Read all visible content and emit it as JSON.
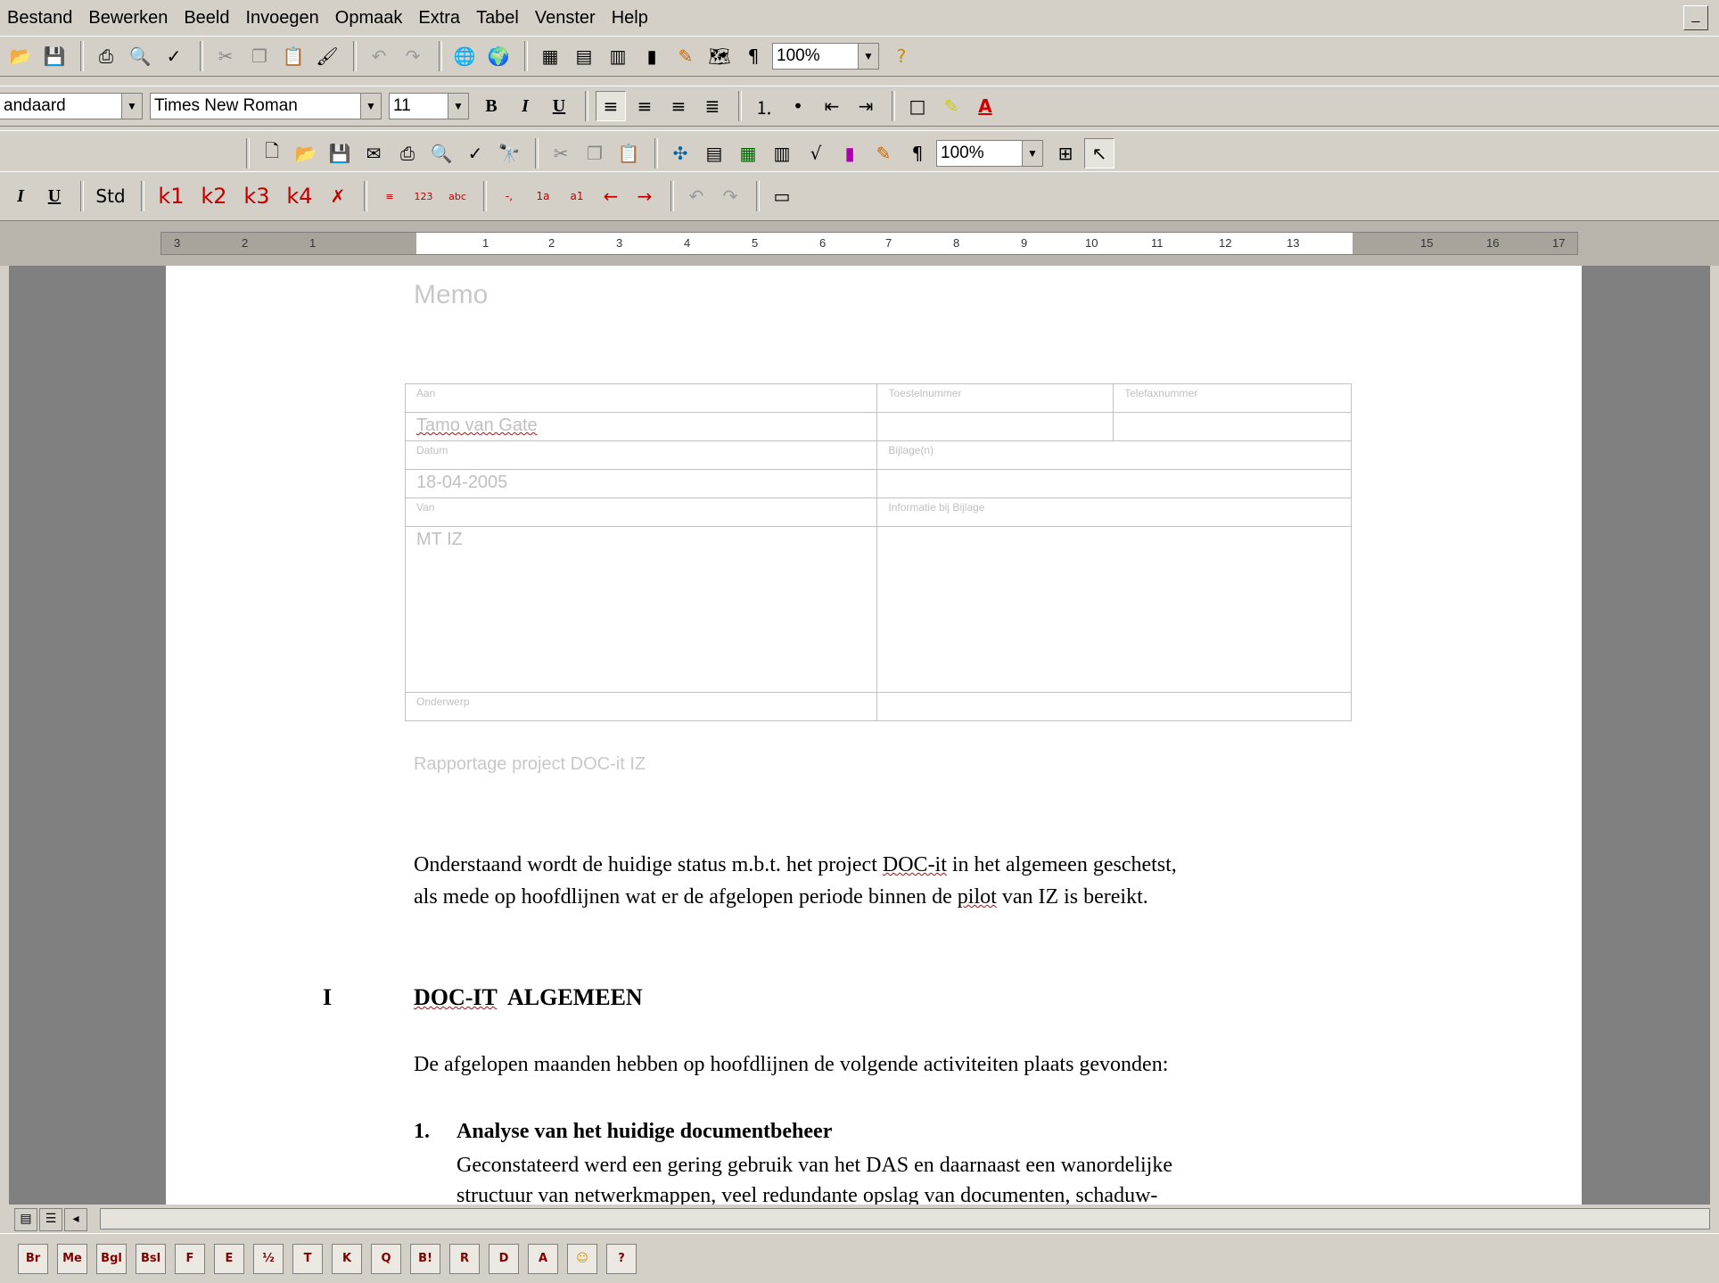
{
  "menubar": {
    "items": [
      "Bestand",
      "Bewerken",
      "Beeld",
      "Invoegen",
      "Opmaak",
      "Extra",
      "Tabel",
      "Venster",
      "Help"
    ],
    "min_button": "_"
  },
  "toolbar1": {
    "icons": [
      "open-icon",
      "save-icon",
      "print-icon",
      "print-preview-icon",
      "spelling-icon",
      "cut-icon",
      "copy-icon",
      "paste-icon",
      "format-painter-icon",
      "undo-icon",
      "redo-icon",
      "hyperlink-icon",
      "web-toolbar-icon",
      "tables-icon",
      "insert-table-icon",
      "insert-excel-icon",
      "columns-icon",
      "drawing-icon",
      "document-map-icon",
      "show-formatting-icon",
      "help-icon"
    ],
    "zoom": "100%"
  },
  "toolbar2": {
    "style": "andaard",
    "font": "Times New Roman",
    "size": "11",
    "bold": "B",
    "italic": "I",
    "underline": "U",
    "font_color_label": "A"
  },
  "toolbar3": {
    "zoom": "100%",
    "pilcrow": "¶"
  },
  "toolbar4": {
    "italic": "I",
    "underline": "U",
    "std": "Std",
    "k1": "k1",
    "k2": "k2",
    "k3": "k3",
    "k4": "k4"
  },
  "ruler": {
    "ticks": [
      "3",
      "2",
      "1",
      "1",
      "2",
      "3",
      "4",
      "5",
      "6",
      "7",
      "8",
      "9",
      "10",
      "11",
      "12",
      "13",
      "15",
      "16",
      "17"
    ]
  },
  "document": {
    "memo_title": "Memo",
    "form": {
      "aan_label": "Aan",
      "toestel_label": "Toestelnummer",
      "telefax_label": "Telefaxnummer",
      "aan_value": "Tamo van Gate",
      "datum_label": "Datum",
      "bijlage_label": "Bijlage(n)",
      "datum_value": "18-04-2005",
      "van_label": "Van",
      "informatie_label": "Informatie bij Bijlage",
      "van_value": "MT IZ",
      "onderwerp_label": "Onderwerp"
    },
    "under_table": "Rapportage project DOC-it IZ",
    "paragraph1_line1_a": "Onderstaand wordt de huidige status m.b.t. het project ",
    "paragraph1_line1_b": "DOC-it",
    "paragraph1_line1_c": " in het algemeen geschetst,",
    "paragraph1_line2_a": "als mede op hoofdlijnen wat er de afgelopen periode binnen de ",
    "paragraph1_line2_b": "pilot",
    "paragraph1_line2_c": " van IZ is bereikt.",
    "heading_num": "I",
    "heading_a": "DOC-IT",
    "heading_b": "  ALGEMEEN",
    "paragraph2": "De afgelopen maanden hebben op hoofdlijnen de volgende activiteiten plaats gevonden:",
    "list_num": "1.",
    "list_title": "Analyse van het huidige documentbeheer",
    "list_line1": "Geconstateerd werd een gering gebruik van het DAS en daarnaast een wanordelijke",
    "list_line2": "structuur van netwerkmappen, veel redundante opslag van documenten, schaduw-"
  },
  "bottom_toolbar": {
    "buttons": [
      "Br",
      "Me",
      "Bgl",
      "Bsl",
      "F",
      "E",
      "½",
      "T",
      "K",
      "Q",
      "B!",
      "R",
      "D",
      "A",
      "☺",
      "?"
    ]
  }
}
